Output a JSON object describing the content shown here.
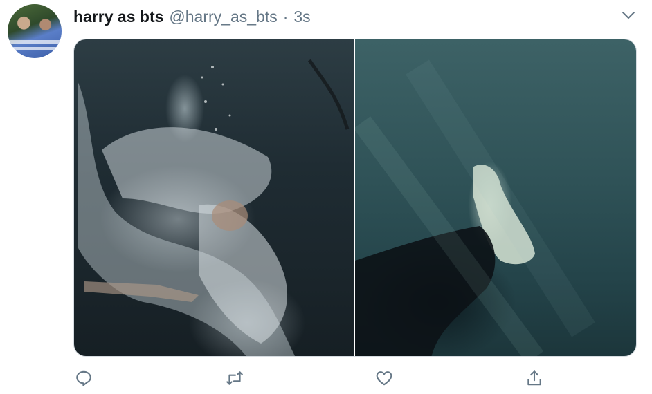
{
  "tweet": {
    "display_name": "harry as bts",
    "handle": "@harry_as_bts",
    "separator": "·",
    "time": "3s"
  },
  "colors": {
    "text_primary": "#14171a",
    "text_secondary": "#657786",
    "icon": "#657786"
  },
  "icons": {
    "menu": "chevron-down-icon",
    "reply": "comment-icon",
    "retweet": "retweet-icon",
    "like": "heart-icon",
    "share": "share-icon"
  },
  "media": {
    "count": 2
  }
}
